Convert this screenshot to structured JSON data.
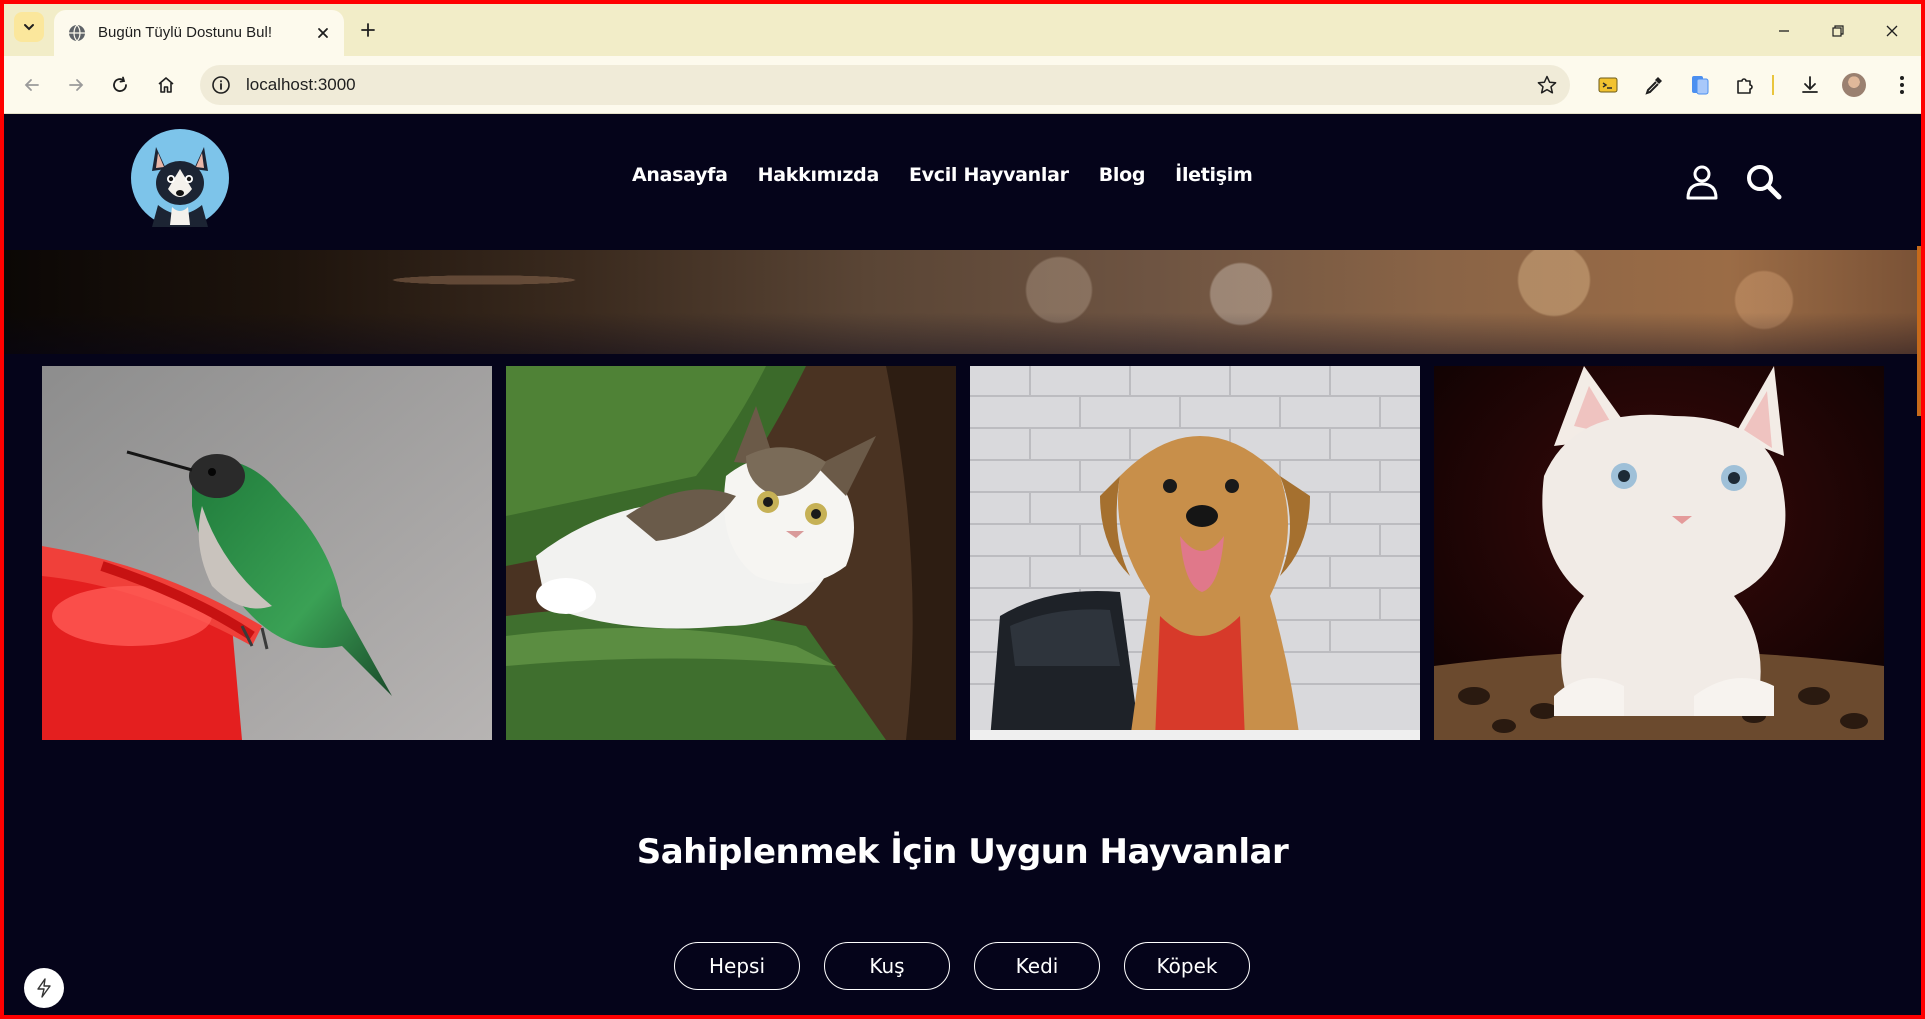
{
  "browser": {
    "tab_title": "Bugün Tüylü Dostunu Bul!",
    "url": "localhost:3000"
  },
  "site": {
    "logo_icon": "dog-logo",
    "nav": [
      "Anasayfa",
      "Hakkımızda",
      "Evcil Hayvanlar",
      "Blog",
      "İletişim"
    ],
    "header_icons": [
      "user-icon",
      "search-icon"
    ],
    "gallery": [
      {
        "subject": "hummingbird"
      },
      {
        "subject": "tabby-white-cat"
      },
      {
        "subject": "golden-retriever"
      },
      {
        "subject": "white-kitten"
      }
    ],
    "section_title": "Sahiplenmek İçin Uygun Hayvanlar",
    "filters": [
      "Hepsi",
      "Kuş",
      "Kedi",
      "Köpek"
    ]
  },
  "colors": {
    "page_bg": "#05041a",
    "text": "#ffffff",
    "chrome_tabbar": "#f2edc8",
    "chrome_toolbar": "#fdfaed",
    "window_border": "#ff0000"
  }
}
